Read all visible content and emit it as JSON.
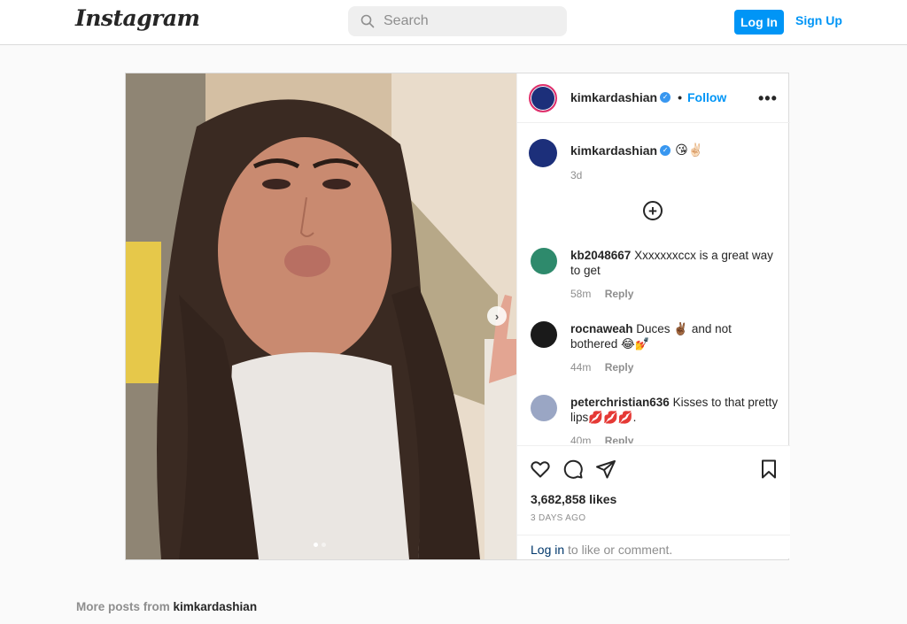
{
  "nav": {
    "logo": "Instagram",
    "search_placeholder": "Search",
    "login": "Log In",
    "signup": "Sign Up"
  },
  "post": {
    "username": "kimkardashian",
    "follow_separator": "•",
    "follow": "Follow",
    "more": "•••",
    "caption": "😘✌🏻",
    "caption_time": "3d",
    "load_more": "+",
    "next": "›",
    "comments": [
      {
        "user": "kb2048667",
        "text": "Xxxxxxxccx is a great way to get",
        "time": "58m",
        "reply": "Reply"
      },
      {
        "user": "rocnaweah",
        "text": "Duces ✌🏾 and not bothered 😂💅",
        "time": "44m",
        "reply": "Reply"
      },
      {
        "user": "peterchristian636",
        "text": "Kisses to that pretty lips💋💋💋.",
        "time": "40m",
        "reply": "Reply"
      }
    ],
    "likes": "3,682,858 likes",
    "date": "3 DAYS AGO",
    "login_link": "Log in",
    "login_rest": " to like or comment."
  },
  "footer": {
    "more_posts_prefix": "More posts from ",
    "more_posts_user": "kimkardashian"
  },
  "colors": {
    "accent": "#0095f6",
    "verified": "#3897f0",
    "border": "#dbdbdb"
  },
  "carousel": {
    "slides": 2,
    "active": 1
  }
}
